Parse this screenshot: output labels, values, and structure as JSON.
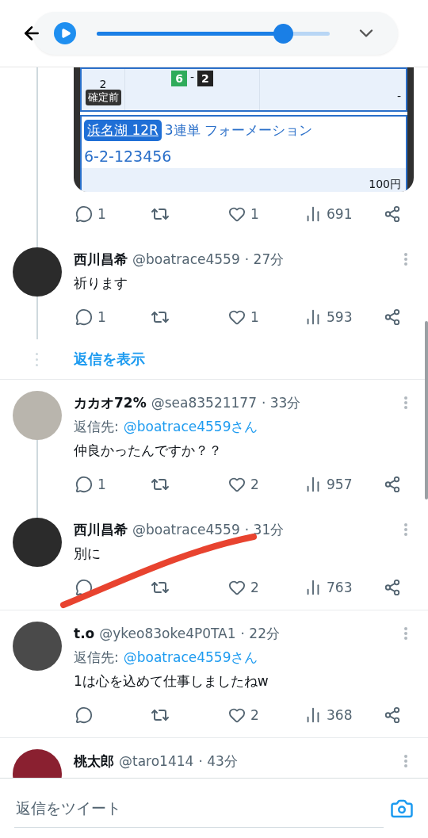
{
  "header": {
    "player": {
      "playing": false,
      "level": 0.8
    }
  },
  "media": {
    "row_1": {
      "number": "2",
      "status": "確定前",
      "result_1": "6",
      "separator": "-",
      "result_2": "2",
      "payout": "-"
    },
    "ticket": {
      "venue": "浜名湖 12R",
      "type": "3連単 フォーメーション",
      "combination": "6-2-123456",
      "amount": "100円"
    }
  },
  "tweets": [
    {
      "kind": "continuation",
      "actions": {
        "replies": "1",
        "likes": "1",
        "views": "691"
      }
    },
    {
      "kind": "tweet",
      "connected_above": true,
      "connected_below": true,
      "name": "西川昌希",
      "handle": "@boatrace4559",
      "time": "· 27分",
      "text": "祈ります",
      "actions": {
        "replies": "1",
        "likes": "1",
        "views": "593"
      },
      "show_replies": "返信を表示"
    },
    {
      "kind": "tweet",
      "connected_above": false,
      "connected_below": true,
      "name": "カカオ72%",
      "handle": "@sea83521177",
      "time": "· 33分",
      "reply_label": "返信先:",
      "reply_to": "@boatrace4559さん",
      "text": "仲良かったんですか？？",
      "actions": {
        "replies": "1",
        "likes": "2",
        "views": "957"
      }
    },
    {
      "kind": "tweet",
      "connected_above": true,
      "connected_below": false,
      "name": "西川昌希",
      "handle": "@boatrace4559",
      "time": "· 31分",
      "text": "別に",
      "actions": {
        "likes": "2",
        "views": "763"
      }
    },
    {
      "kind": "tweet",
      "connected_above": false,
      "connected_below": false,
      "name": "t.o",
      "handle": "@ykeo83oke4P0TA1",
      "time": "· 22分",
      "reply_label": "返信先:",
      "reply_to": "@boatrace4559さん",
      "text": "1は心を込めて仕事しましたねw",
      "actions": {
        "likes": "2",
        "views": "368"
      }
    },
    {
      "kind": "tweet",
      "connected_above": false,
      "connected_below": false,
      "name": "桃太郎",
      "handle": "@taro1414",
      "time": "· 43分"
    }
  ],
  "composer": {
    "placeholder": "返信をツイート"
  }
}
